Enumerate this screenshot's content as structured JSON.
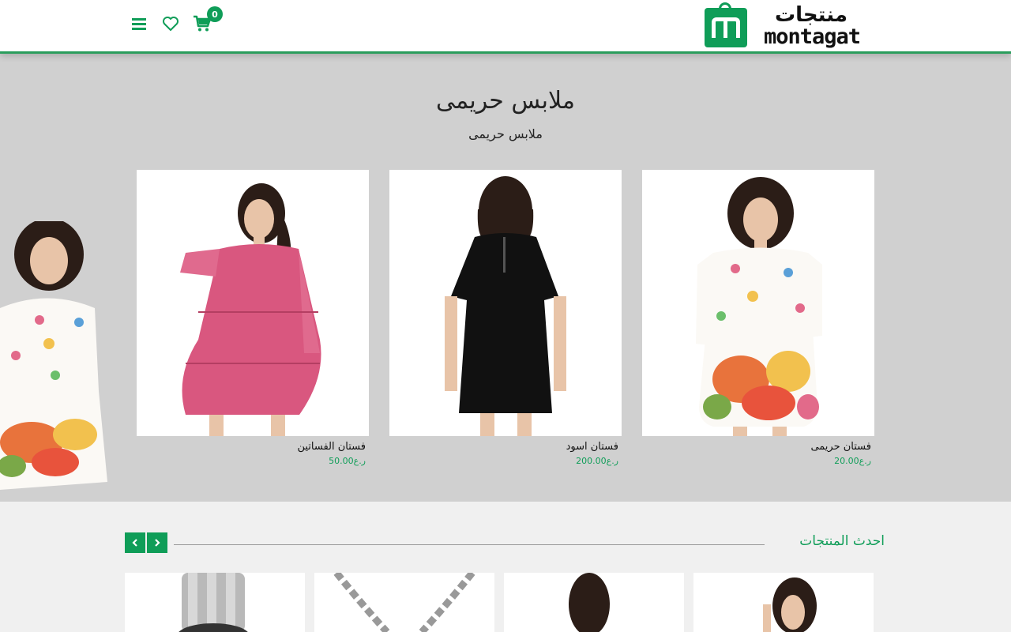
{
  "brand": {
    "name_ar": "منتجات",
    "name_en": "montagat",
    "accent": "#0f9d58"
  },
  "header": {
    "cart_count": "0",
    "icons": [
      "menu-icon",
      "heart-icon",
      "cart-icon"
    ]
  },
  "hero": {
    "title": "ملابس حريمى",
    "subtitle": "ملابس حريمى",
    "products": [
      {
        "name": "فستان الفساتين",
        "price": "50.00ر.ع"
      },
      {
        "name": "فستان اسود",
        "price": "200.00ر.ع"
      },
      {
        "name": "فستان حريمى",
        "price": "20.00ر.ع"
      }
    ]
  },
  "latest": {
    "title": "احدث المنتجات",
    "prev_icon": "chevron-left-icon",
    "next_icon": "chevron-right-icon"
  }
}
